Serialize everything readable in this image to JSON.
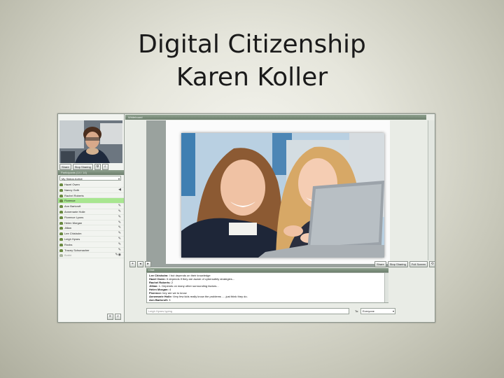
{
  "slide": {
    "title_line1": "Digital Citizenship",
    "title_line2": "Karen Koller"
  },
  "app": {
    "webcam_buttons": {
      "share": "Share",
      "stop_sharing": "Stop Sharing"
    },
    "participants_header": "Participants (14 / 14)",
    "status_select": "My Status:Active",
    "participants": [
      {
        "name": "Hazel Owen",
        "highlight": false,
        "disabled": false
      },
      {
        "name": "Nancy Goth",
        "highlight": false,
        "disabled": false
      },
      {
        "name": "Rachel Roberts",
        "highlight": false,
        "disabled": false
      },
      {
        "name": "Florence",
        "highlight": true,
        "disabled": false
      },
      {
        "name": "Ann Bartcroft",
        "highlight": false,
        "disabled": false
      },
      {
        "name": "Annemarie Hoile",
        "highlight": false,
        "disabled": false
      },
      {
        "name": "Florence Lyons",
        "highlight": false,
        "disabled": false
      },
      {
        "name": "Helen Morgan",
        "highlight": false,
        "disabled": false
      },
      {
        "name": "Jillian",
        "highlight": false,
        "disabled": false
      },
      {
        "name": "Lee Chisholm",
        "highlight": false,
        "disabled": false
      },
      {
        "name": "Leigh Hynes",
        "highlight": false,
        "disabled": false
      },
      {
        "name": "Rooks",
        "highlight": false,
        "disabled": false
      },
      {
        "name": "Tracey Schumacher",
        "highlight": false,
        "disabled": false
      },
      {
        "name": "Bobbi",
        "highlight": false,
        "disabled": true
      }
    ],
    "whiteboard_header": "Whiteboard",
    "whiteboard_toolbar": {
      "share": "Share",
      "stop_sharing": "Stop Sharing",
      "full_screen": "Full Screen"
    },
    "chat_header": "Chat",
    "chat_lines": [
      {
        "who": "Lee Chisholm:",
        "text": " I but depends on their knowledge"
      },
      {
        "who": "Hazel Owen:",
        "text": " It depends if they are aware of cybersafety strategies..."
      },
      {
        "who": "Rachel Roberts:",
        "text": " 2"
      },
      {
        "who": "Jillian:",
        "text": " 1. Depends on many other surrounding factors..."
      },
      {
        "who": "Helen Morgan:",
        "text": " 4"
      },
      {
        "who": "Florence:",
        "text": " hey are we to know"
      },
      {
        "who": "Annemarie Hoile:",
        "text": " Very few kids really know the problems .....just think they do."
      },
      {
        "who": "Ann Bartcroft:",
        "text": " 3"
      }
    ],
    "chat_input_placeholder": "Leigh Hynes typing",
    "to_label": "To:",
    "to_value": "Everyone"
  }
}
